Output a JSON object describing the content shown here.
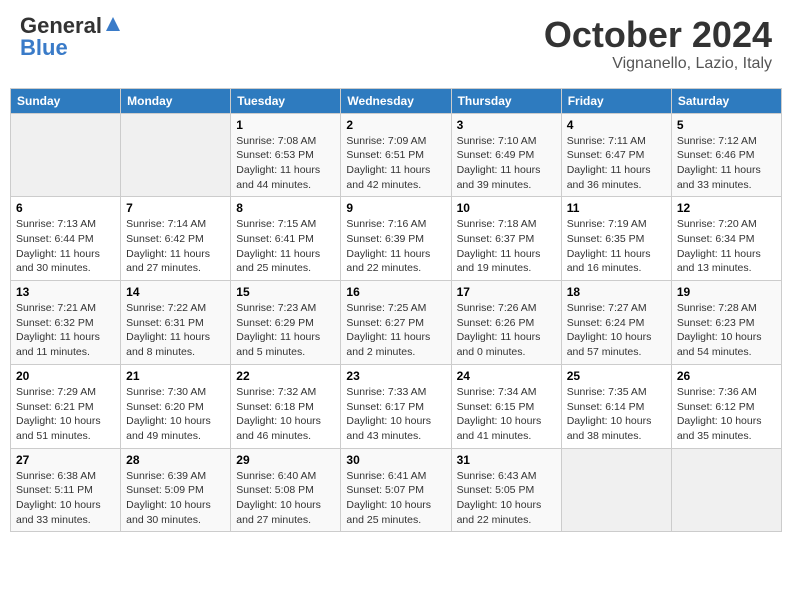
{
  "header": {
    "logo_general": "General",
    "logo_blue": "Blue",
    "month_title": "October 2024",
    "location": "Vignanello, Lazio, Italy"
  },
  "weekdays": [
    "Sunday",
    "Monday",
    "Tuesday",
    "Wednesday",
    "Thursday",
    "Friday",
    "Saturday"
  ],
  "weeks": [
    [
      null,
      null,
      {
        "day": 1,
        "sunrise": "7:08 AM",
        "sunset": "6:53 PM",
        "daylight": "11 hours and 44 minutes."
      },
      {
        "day": 2,
        "sunrise": "7:09 AM",
        "sunset": "6:51 PM",
        "daylight": "11 hours and 42 minutes."
      },
      {
        "day": 3,
        "sunrise": "7:10 AM",
        "sunset": "6:49 PM",
        "daylight": "11 hours and 39 minutes."
      },
      {
        "day": 4,
        "sunrise": "7:11 AM",
        "sunset": "6:47 PM",
        "daylight": "11 hours and 36 minutes."
      },
      {
        "day": 5,
        "sunrise": "7:12 AM",
        "sunset": "6:46 PM",
        "daylight": "11 hours and 33 minutes."
      }
    ],
    [
      {
        "day": 6,
        "sunrise": "7:13 AM",
        "sunset": "6:44 PM",
        "daylight": "11 hours and 30 minutes."
      },
      {
        "day": 7,
        "sunrise": "7:14 AM",
        "sunset": "6:42 PM",
        "daylight": "11 hours and 27 minutes."
      },
      {
        "day": 8,
        "sunrise": "7:15 AM",
        "sunset": "6:41 PM",
        "daylight": "11 hours and 25 minutes."
      },
      {
        "day": 9,
        "sunrise": "7:16 AM",
        "sunset": "6:39 PM",
        "daylight": "11 hours and 22 minutes."
      },
      {
        "day": 10,
        "sunrise": "7:18 AM",
        "sunset": "6:37 PM",
        "daylight": "11 hours and 19 minutes."
      },
      {
        "day": 11,
        "sunrise": "7:19 AM",
        "sunset": "6:35 PM",
        "daylight": "11 hours and 16 minutes."
      },
      {
        "day": 12,
        "sunrise": "7:20 AM",
        "sunset": "6:34 PM",
        "daylight": "11 hours and 13 minutes."
      }
    ],
    [
      {
        "day": 13,
        "sunrise": "7:21 AM",
        "sunset": "6:32 PM",
        "daylight": "11 hours and 11 minutes."
      },
      {
        "day": 14,
        "sunrise": "7:22 AM",
        "sunset": "6:31 PM",
        "daylight": "11 hours and 8 minutes."
      },
      {
        "day": 15,
        "sunrise": "7:23 AM",
        "sunset": "6:29 PM",
        "daylight": "11 hours and 5 minutes."
      },
      {
        "day": 16,
        "sunrise": "7:25 AM",
        "sunset": "6:27 PM",
        "daylight": "11 hours and 2 minutes."
      },
      {
        "day": 17,
        "sunrise": "7:26 AM",
        "sunset": "6:26 PM",
        "daylight": "11 hours and 0 minutes."
      },
      {
        "day": 18,
        "sunrise": "7:27 AM",
        "sunset": "6:24 PM",
        "daylight": "10 hours and 57 minutes."
      },
      {
        "day": 19,
        "sunrise": "7:28 AM",
        "sunset": "6:23 PM",
        "daylight": "10 hours and 54 minutes."
      }
    ],
    [
      {
        "day": 20,
        "sunrise": "7:29 AM",
        "sunset": "6:21 PM",
        "daylight": "10 hours and 51 minutes."
      },
      {
        "day": 21,
        "sunrise": "7:30 AM",
        "sunset": "6:20 PM",
        "daylight": "10 hours and 49 minutes."
      },
      {
        "day": 22,
        "sunrise": "7:32 AM",
        "sunset": "6:18 PM",
        "daylight": "10 hours and 46 minutes."
      },
      {
        "day": 23,
        "sunrise": "7:33 AM",
        "sunset": "6:17 PM",
        "daylight": "10 hours and 43 minutes."
      },
      {
        "day": 24,
        "sunrise": "7:34 AM",
        "sunset": "6:15 PM",
        "daylight": "10 hours and 41 minutes."
      },
      {
        "day": 25,
        "sunrise": "7:35 AM",
        "sunset": "6:14 PM",
        "daylight": "10 hours and 38 minutes."
      },
      {
        "day": 26,
        "sunrise": "7:36 AM",
        "sunset": "6:12 PM",
        "daylight": "10 hours and 35 minutes."
      }
    ],
    [
      {
        "day": 27,
        "sunrise": "6:38 AM",
        "sunset": "5:11 PM",
        "daylight": "10 hours and 33 minutes."
      },
      {
        "day": 28,
        "sunrise": "6:39 AM",
        "sunset": "5:09 PM",
        "daylight": "10 hours and 30 minutes."
      },
      {
        "day": 29,
        "sunrise": "6:40 AM",
        "sunset": "5:08 PM",
        "daylight": "10 hours and 27 minutes."
      },
      {
        "day": 30,
        "sunrise": "6:41 AM",
        "sunset": "5:07 PM",
        "daylight": "10 hours and 25 minutes."
      },
      {
        "day": 31,
        "sunrise": "6:43 AM",
        "sunset": "5:05 PM",
        "daylight": "10 hours and 22 minutes."
      },
      null,
      null
    ]
  ],
  "labels": {
    "sunrise": "Sunrise:",
    "sunset": "Sunset:",
    "daylight": "Daylight:"
  }
}
